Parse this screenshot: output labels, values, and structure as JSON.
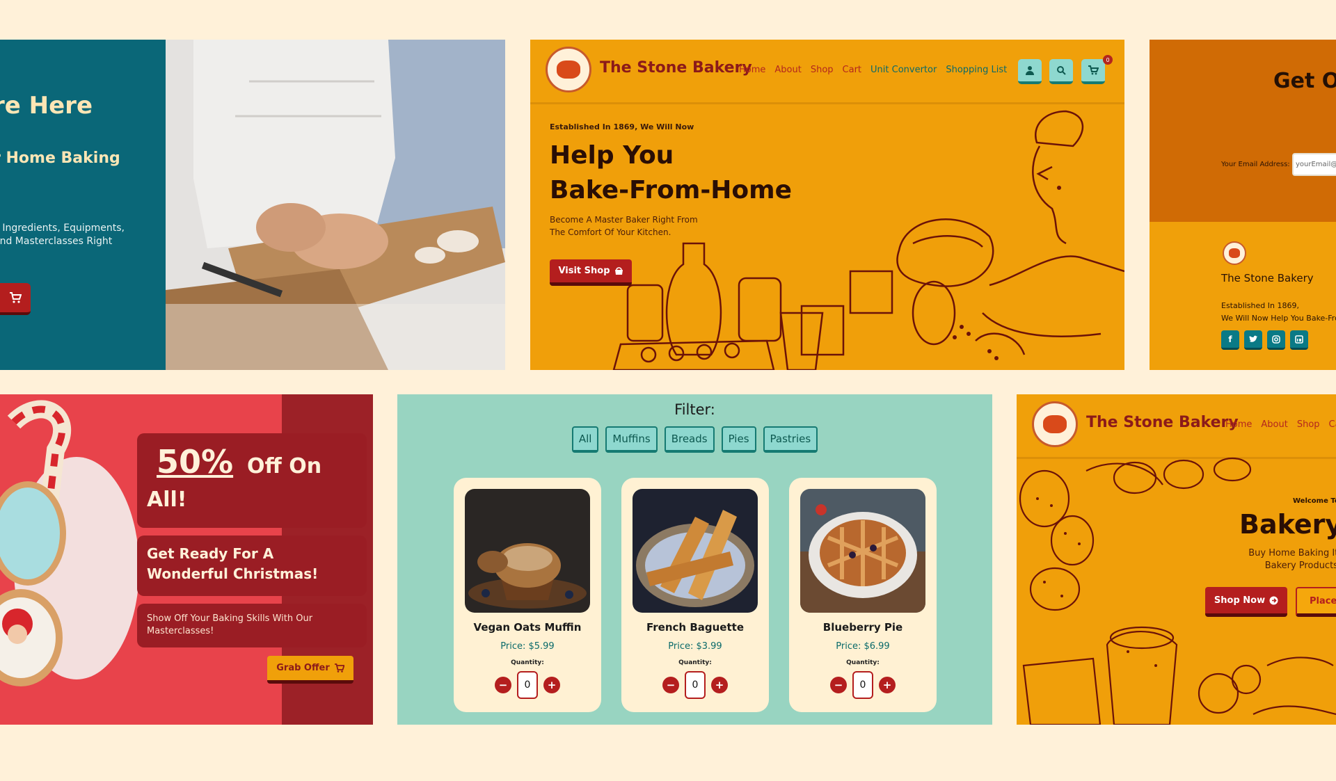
{
  "colors": {
    "background": "#fff1d9",
    "mustard": "#f09f0a",
    "teal": "#0a6778",
    "red": "#b41e1e",
    "mint": "#98d4c1"
  },
  "cardA": {
    "title": "re Here",
    "subtitle": "r Home Baking",
    "desc_line1": "g Ingredients, Equipments,",
    "desc_line2": "And Masterclasses Right",
    "cart_icon": "cart-icon"
  },
  "cardB": {
    "logo_icon": "stone-bakery-logo",
    "brand": "The Stone Bakery",
    "nav": [
      "Home",
      "About",
      "Shop",
      "Cart",
      "Unit Convertor",
      "Shopping List"
    ],
    "icons": [
      "user-icon",
      "search-icon",
      "cart-icon"
    ],
    "cart_count": "0",
    "established": "Established In 1869, We Will Now",
    "headline_line1": "Help You",
    "headline_line2": "Bake-From-Home",
    "desc_line1": "Become A Master Baker Right From",
    "desc_line2": "The Comfort Of Your Kitchen.",
    "cta": "Visit Shop"
  },
  "cardC": {
    "heading": "Get Ou",
    "email_label": "Your Email Address:",
    "email_placeholder": "yourEmail@d",
    "brand": "The Stone Bakery",
    "est_line1": "Established In 1869,",
    "est_line2": "We Will Now Help You Bake-From",
    "socials": [
      "facebook-icon",
      "twitter-icon",
      "instagram-icon",
      "linkedin-icon"
    ]
  },
  "cardD": {
    "percent": "50%",
    "off_on": "Off On",
    "all": "All!",
    "headline": "Get Ready For A Wonderful Christmas!",
    "desc": "Show Off Your Baking Skills With Our Masterclasses!",
    "cta": "Grab Offer"
  },
  "cardE": {
    "filter_title": "Filter:",
    "filters": [
      "All",
      "Muffins",
      "Breads",
      "Pies",
      "Pastries"
    ],
    "quantity_label": "Quantity:",
    "products": [
      {
        "name": "Vegan Oats Muffin",
        "price": "Price: $5.99",
        "qty": "0"
      },
      {
        "name": "French Baguette",
        "price": "Price: $3.99",
        "qty": "0"
      },
      {
        "name": "Blueberry Pie",
        "price": "Price: $6.99",
        "qty": "0"
      }
    ]
  },
  "cardF": {
    "brand": "The Stone Bakery",
    "nav": [
      "Home",
      "About",
      "Shop",
      "Ca"
    ],
    "welcome": "Welcome To",
    "headline": "Bakery S",
    "desc_line1": "Buy Home Baking Items, Mas",
    "desc_line2": "Bakery Products Right Fro",
    "cta_primary": "Shop Now",
    "cta_secondary": "Place"
  }
}
